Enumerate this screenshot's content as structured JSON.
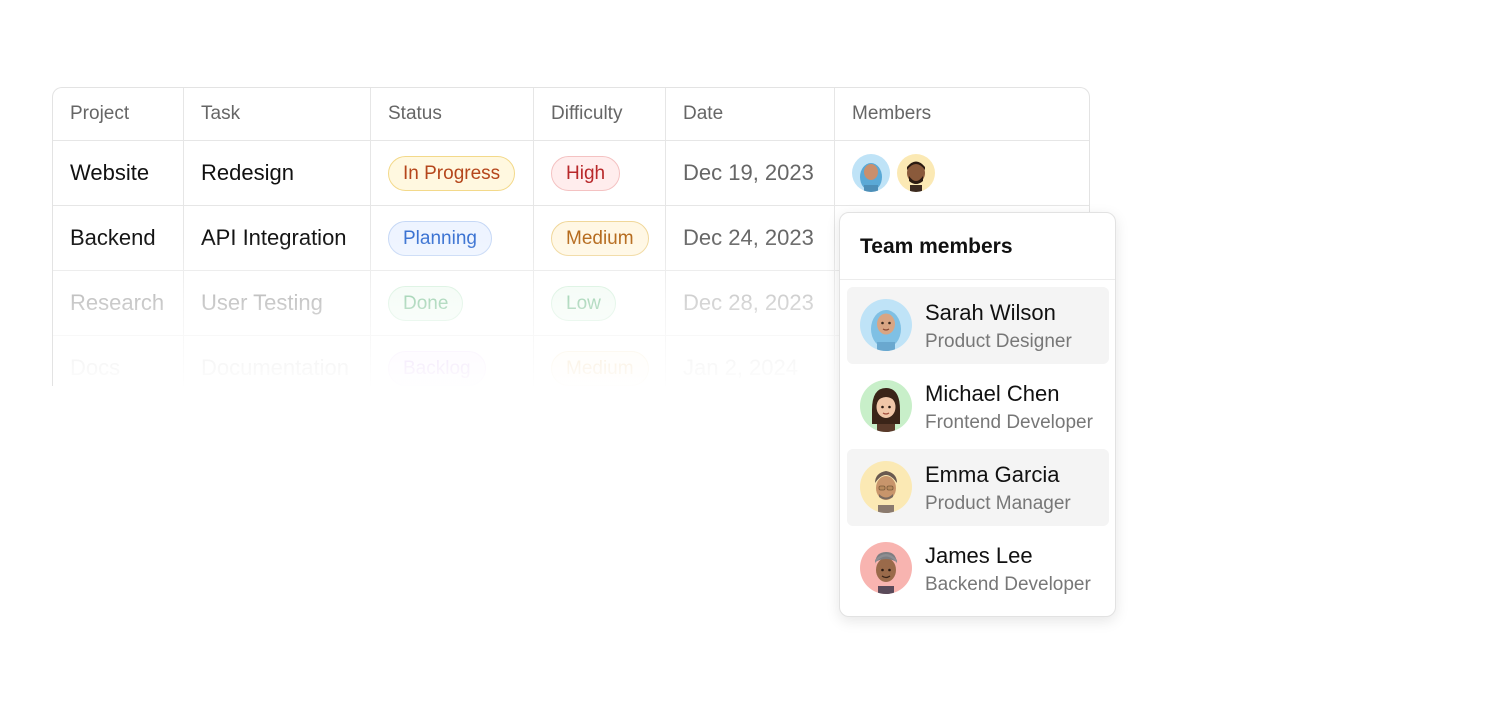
{
  "table": {
    "columns": [
      "Project",
      "Task",
      "Status",
      "Difficulty",
      "Date",
      "Members"
    ],
    "rows": [
      {
        "project": "Website",
        "task": "Redesign",
        "status": "In Progress",
        "difficulty": "High",
        "date": "Dec 19, 2023"
      },
      {
        "project": "Backend",
        "task": "API Integration",
        "status": "Planning",
        "difficulty": "Medium",
        "date": "Dec 24, 2023"
      },
      {
        "project": "Research",
        "task": "User Testing",
        "status": "Done",
        "difficulty": "Low",
        "date": "Dec 28, 2023"
      },
      {
        "project": "Docs",
        "task": "Documentation",
        "status": "Backlog",
        "difficulty": "Medium",
        "date": "Jan 2, 2024"
      }
    ]
  },
  "popover": {
    "title": "Team members",
    "members": [
      {
        "name": "Sarah Wilson",
        "role": "Product Designer",
        "avatar_bg": "#bfe3f7"
      },
      {
        "name": "Michael Chen",
        "role": "Frontend Developer",
        "avatar_bg": "#c8efc9"
      },
      {
        "name": "Emma Garcia",
        "role": "Product Manager",
        "avatar_bg": "#fbe9b4"
      },
      {
        "name": "James Lee",
        "role": "Backend Developer",
        "avatar_bg": "#f8b4b0"
      }
    ]
  },
  "colors": {
    "in_progress": "#b5461b",
    "high": "#b8282a",
    "planning": "#3a72d2",
    "medium": "#b56a1c",
    "done": "#5cb27a"
  }
}
